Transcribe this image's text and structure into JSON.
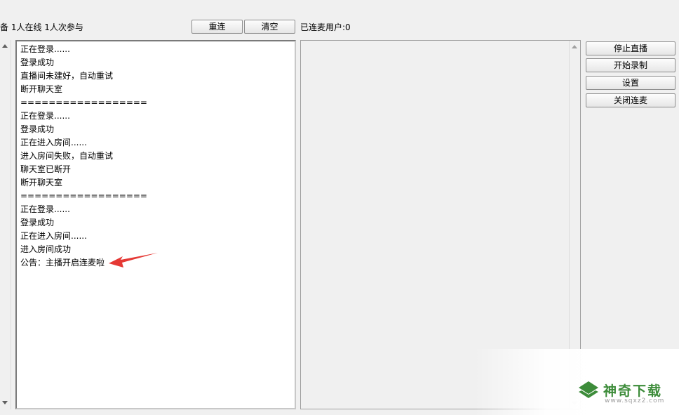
{
  "header": {
    "status_text": "备  1人在线 1人次参与",
    "reconnect_label": "重连",
    "clear_label": "清空",
    "connected_users_label": "已连麦用户:0"
  },
  "log": {
    "lines": [
      "正在登录......",
      "登录成功",
      "直播间未建好，自动重试",
      "断开聊天室",
      "==================",
      "正在登录......",
      "登录成功",
      "正在进入房间......",
      "进入房间失败，自动重试",
      "聊天室已断开",
      "断开聊天室",
      "==================",
      "正在登录......",
      "登录成功",
      "正在进入房间......",
      "进入房间成功",
      "公告：主播开启连麦啦"
    ]
  },
  "side_buttons": {
    "stop_broadcast": "停止直播",
    "start_recording": "开始录制",
    "settings": "设置",
    "close_mic_link": "关闭连麦"
  },
  "watermark": {
    "title": "神奇下载",
    "url": "www.sqxz2.com"
  },
  "colors": {
    "annotation_arrow": "#e53935",
    "watermark_green": "#3d8c3a"
  }
}
